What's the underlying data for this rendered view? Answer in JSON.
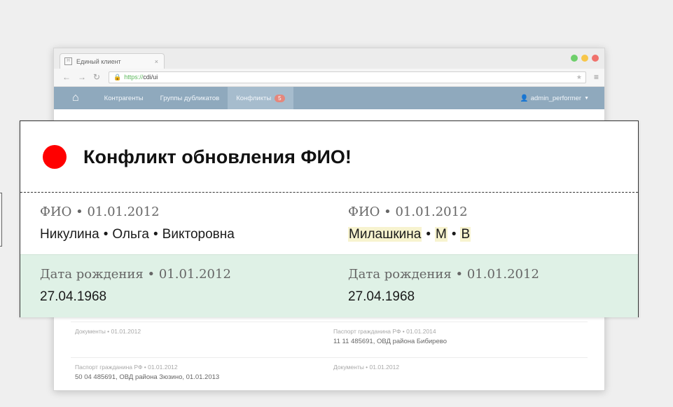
{
  "browser": {
    "tab_title": "Единый клиент",
    "tab_close": "×",
    "url_scheme": "https://",
    "url_rest": "cdi/ui",
    "window_dot_colors": [
      "#6ecf6b",
      "#f7c64a",
      "#f0726c"
    ]
  },
  "navbar": {
    "home_icon": "home-icon",
    "items": [
      "Контрагенты",
      "Группы дубликатов",
      "Конфликты"
    ],
    "conflicts_count": "5",
    "user": "admin_performer",
    "bg_color": "#8fa9bd"
  },
  "background_rows": [
    {
      "left_label": "Документы • 01.01.2012",
      "left_value": "",
      "right_label": "Паспорт гражданина РФ • 01.01.2014",
      "right_value": "11 11 485691, ОВД района Бибирево"
    },
    {
      "left_label": "Паспорт гражданина РФ • 01.01.2012",
      "left_value": "50 04 485691, ОВД района Зюзино, 01.01.2013",
      "right_label": "Документы • 01.01.2012",
      "right_value": ""
    }
  ],
  "conflict": {
    "title": "Конфликт обновления ФИО!",
    "status_color": "#ff0000",
    "name_left": {
      "label": "ФИО • 01.01.2012",
      "last": "Никулина",
      "first": "Ольга",
      "middle": "Викторовна"
    },
    "name_right": {
      "label": "ФИО • 01.01.2012",
      "last": "Милашкина",
      "first": "М",
      "middle": "В"
    },
    "birth_left": {
      "label": "Дата рождения • 01.01.2012",
      "value": "27.04.1968"
    },
    "birth_right": {
      "label": "Дата рождения • 01.01.2012",
      "value": "27.04.1968"
    },
    "separator": "•",
    "highlight_color": "#f7f3cf",
    "row_match_color": "#dff1e6"
  }
}
